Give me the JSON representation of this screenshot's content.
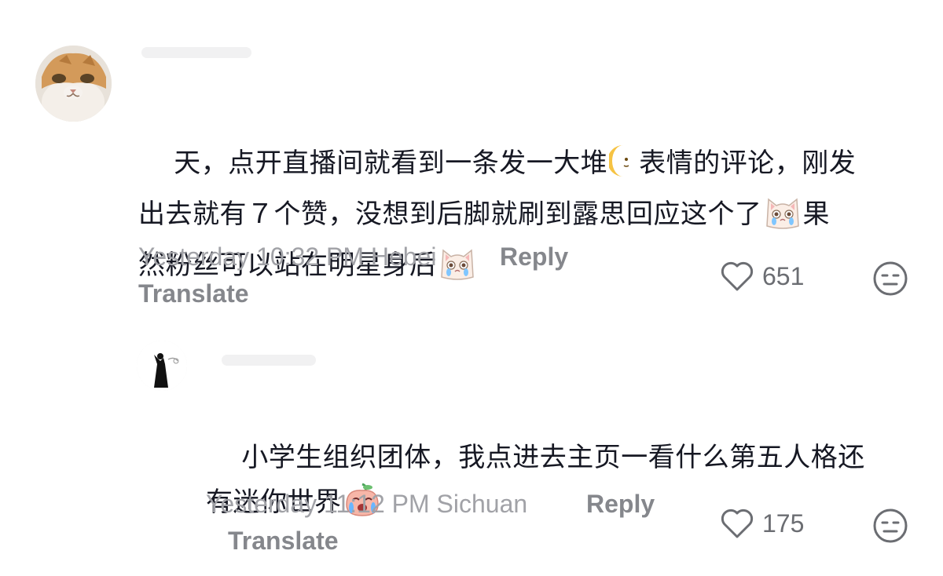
{
  "comments": [
    {
      "text_line1": "天，点开直播间就看到一条发一大堆",
      "text_line1b": "表情的评论，刚发",
      "text_line2": "出去就有７个赞，没想到后脚就刷到露思回应这个了",
      "text_line2b": "果",
      "text_line3": "然粉丝可以站在明星身后",
      "meta": "Yesterday 10:32 PM Hebei",
      "reply_label": "Reply",
      "translate_label": "Translate",
      "likes": "651",
      "inline_emojis": [
        "crescent-moon-icon",
        "crying-cat-icon",
        "crying-cat-icon"
      ]
    },
    {
      "text_line1": "小学生组织团体，我点进去主页一看什么第五人格还",
      "text_line2": "有迷你世界",
      "meta": "Yesterday 11:12 PM Sichuan",
      "reply_label": "Reply",
      "translate_label": "Translate",
      "likes": "175",
      "inline_emojis": [
        "crying-peach-icon"
      ]
    }
  ],
  "colors": {
    "text": "#161823",
    "meta": "#a1a2a7",
    "action": "#85878c",
    "icon": "#6b6d72"
  }
}
